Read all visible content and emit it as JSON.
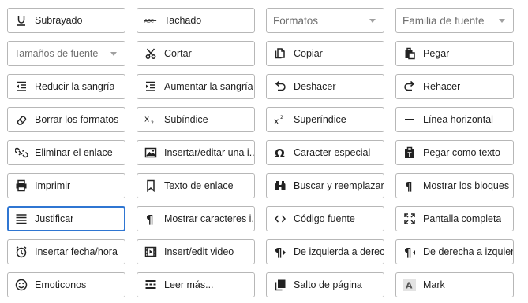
{
  "toolbar_options": [
    {
      "label": "Subrayado",
      "icon": "underline-icon"
    },
    {
      "label": "Tachado",
      "icon": "strikethrough-icon"
    },
    {
      "label": "Formatos",
      "control": "select"
    },
    {
      "label": "Familia de fuente",
      "control": "select"
    },
    {
      "label": "Tamaños de fuente",
      "control": "select"
    },
    {
      "label": "Cortar",
      "icon": "scissors-icon"
    },
    {
      "label": "Copiar",
      "icon": "copy-icon"
    },
    {
      "label": "Pegar",
      "icon": "paste-icon"
    },
    {
      "label": "Reducir la sangría",
      "icon": "outdent-icon"
    },
    {
      "label": "Aumentar la sangría",
      "icon": "indent-icon"
    },
    {
      "label": "Deshacer",
      "icon": "undo-icon"
    },
    {
      "label": "Rehacer",
      "icon": "redo-icon"
    },
    {
      "label": "Borrar los formatos",
      "icon": "eraser-icon"
    },
    {
      "label": "Subíndice",
      "icon": "subscript-icon"
    },
    {
      "label": "Superíndice",
      "icon": "superscript-icon"
    },
    {
      "label": "Línea horizontal",
      "icon": "horizontal-line-icon"
    },
    {
      "label": "Eliminar el enlace",
      "icon": "unlink-icon"
    },
    {
      "label": "Insertar/editar una i...",
      "icon": "image-icon"
    },
    {
      "label": "Caracter especial",
      "icon": "omega-icon"
    },
    {
      "label": "Pegar como texto",
      "icon": "paste-text-icon"
    },
    {
      "label": "Imprimir",
      "icon": "print-icon"
    },
    {
      "label": "Texto de enlace",
      "icon": "bookmark-icon"
    },
    {
      "label": "Buscar y reemplazar",
      "icon": "binoculars-icon"
    },
    {
      "label": "Mostrar los bloques",
      "icon": "pilcrow-icon"
    },
    {
      "label": "Justificar",
      "icon": "align-justify-icon",
      "selected": true
    },
    {
      "label": "Mostrar caracteres i...",
      "icon": "pilcrow-icon"
    },
    {
      "label": "Código fuente",
      "icon": "code-icon"
    },
    {
      "label": "Pantalla completa",
      "icon": "fullscreen-icon"
    },
    {
      "label": "Insertar fecha/hora",
      "icon": "alarm-clock-icon"
    },
    {
      "label": "Insert/edit video",
      "icon": "video-icon"
    },
    {
      "label": "De izquierda a derec...",
      "icon": "ltr-icon"
    },
    {
      "label": "De derecha a izquier...",
      "icon": "rtl-icon"
    },
    {
      "label": "Emoticonos",
      "icon": "smiley-icon"
    },
    {
      "label": "Leer más...",
      "icon": "read-more-icon"
    },
    {
      "label": "Salto de página",
      "icon": "page-break-icon"
    },
    {
      "label": "Mark",
      "icon": "mark-icon"
    }
  ],
  "colors": {
    "selected_border": "#2f76d2",
    "tile_border": "#b7b7b7",
    "text": "#222222",
    "placeholder": "#6f6f6f"
  }
}
